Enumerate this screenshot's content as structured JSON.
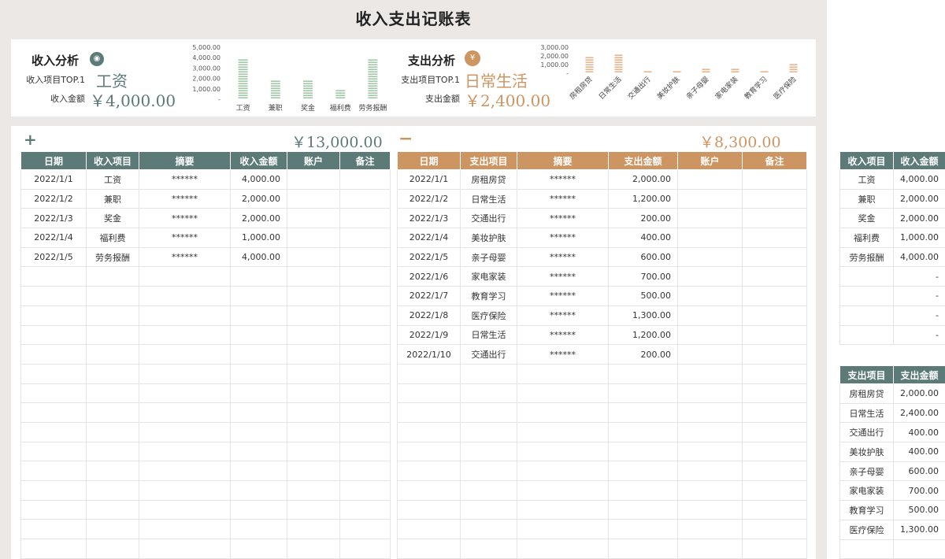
{
  "title": "收入支出记账表",
  "colors": {
    "income": "#5b7a78",
    "expense": "#cd9562",
    "income_bar": "#9fc9a7",
    "expense_bar": "#e8b58c"
  },
  "income_analysis": {
    "title": "收入分析",
    "icon": "money-bag-icon",
    "top_label": "收入项目TOP.1",
    "top_value": "工资",
    "amount_label": "收入金额",
    "amount_value": "￥4,000.00",
    "chart_data": {
      "type": "bar",
      "categories": [
        "工资",
        "兼职",
        "奖金",
        "福利费",
        "劳务报酬"
      ],
      "values": [
        4000,
        2000,
        2000,
        1000,
        4000
      ],
      "ylim": [
        0,
        5000
      ],
      "yticks": [
        "-",
        "1,000.00",
        "2,000.00",
        "3,000.00",
        "4,000.00",
        "5,000.00"
      ]
    }
  },
  "expense_analysis": {
    "title": "支出分析",
    "icon": "yen-coin-icon",
    "top_label": "支出项目TOP.1",
    "top_value": "日常生活",
    "amount_label": "支出金额",
    "amount_value": "￥2,400.00",
    "chart_data": {
      "type": "bar",
      "categories": [
        "房租房贷",
        "日常生活",
        "交通出行",
        "美妆护肤",
        "亲子母婴",
        "家电家装",
        "教育学习",
        "医疗保险"
      ],
      "values": [
        2000,
        2400,
        400,
        400,
        600,
        700,
        500,
        1300
      ],
      "ylim": [
        0,
        3000
      ],
      "yticks": [
        "-",
        "1,000.00",
        "2,000.00",
        "3,000.00"
      ]
    }
  },
  "income_total": {
    "symbol": "+",
    "value": "￥13,000.00"
  },
  "expense_total": {
    "symbol": "−",
    "value": "￥8,300.00"
  },
  "income_table": {
    "headers": [
      "日期",
      "收入项目",
      "摘要",
      "收入金额",
      "账户",
      "备注"
    ],
    "rows": [
      [
        "2022/1/1",
        "工资",
        "******",
        "4,000.00",
        "",
        ""
      ],
      [
        "2022/1/2",
        "兼职",
        "******",
        "2,000.00",
        "",
        ""
      ],
      [
        "2022/1/3",
        "奖金",
        "******",
        "2,000.00",
        "",
        ""
      ],
      [
        "2022/1/4",
        "福利费",
        "******",
        "1,000.00",
        "",
        ""
      ],
      [
        "2022/1/5",
        "劳务报酬",
        "******",
        "4,000.00",
        "",
        ""
      ]
    ]
  },
  "expense_table": {
    "headers": [
      "日期",
      "支出项目",
      "摘要",
      "支出金额",
      "账户",
      "备注"
    ],
    "rows": [
      [
        "2022/1/1",
        "房租房贷",
        "******",
        "2,000.00",
        "",
        ""
      ],
      [
        "2022/1/2",
        "日常生活",
        "******",
        "1,200.00",
        "",
        ""
      ],
      [
        "2022/1/3",
        "交通出行",
        "******",
        "200.00",
        "",
        ""
      ],
      [
        "2022/1/4",
        "美妆护肤",
        "******",
        "400.00",
        "",
        ""
      ],
      [
        "2022/1/5",
        "亲子母婴",
        "******",
        "600.00",
        "",
        ""
      ],
      [
        "2022/1/6",
        "家电家装",
        "******",
        "700.00",
        "",
        ""
      ],
      [
        "2022/1/7",
        "教育学习",
        "******",
        "500.00",
        "",
        ""
      ],
      [
        "2022/1/8",
        "医疗保险",
        "******",
        "1,300.00",
        "",
        ""
      ],
      [
        "2022/1/9",
        "日常生活",
        "******",
        "1,200.00",
        "",
        ""
      ],
      [
        "2022/1/10",
        "交通出行",
        "******",
        "200.00",
        "",
        ""
      ]
    ]
  },
  "income_summary": {
    "headers": [
      "收入项目",
      "收入金额"
    ],
    "rows": [
      [
        "工资",
        "4,000.00"
      ],
      [
        "兼职",
        "2,000.00"
      ],
      [
        "奖金",
        "2,000.00"
      ],
      [
        "福利费",
        "1,000.00"
      ],
      [
        "劳务报酬",
        "4,000.00"
      ],
      [
        "",
        "-"
      ],
      [
        "",
        "-"
      ],
      [
        "",
        "-"
      ],
      [
        "",
        "-"
      ]
    ]
  },
  "expense_summary": {
    "headers": [
      "支出项目",
      "支出金额"
    ],
    "rows": [
      [
        "房租房贷",
        "2,000.00"
      ],
      [
        "日常生活",
        "2,400.00"
      ],
      [
        "交通出行",
        "400.00"
      ],
      [
        "美妆护肤",
        "400.00"
      ],
      [
        "亲子母婴",
        "600.00"
      ],
      [
        "家电家装",
        "700.00"
      ],
      [
        "教育学习",
        "500.00"
      ],
      [
        "医疗保险",
        "1,300.00"
      ],
      [
        "",
        ""
      ]
    ]
  }
}
